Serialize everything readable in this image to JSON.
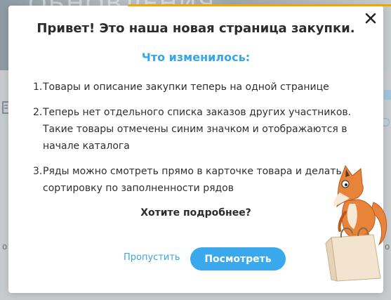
{
  "background": {
    "banner_text": "ОБНОВЛЕНИЯ",
    "left_fragment": "о",
    "right_fragment": "о"
  },
  "modal": {
    "title": "Привет! Это наша новая страница закупки.",
    "subtitle": "Что изменилось:",
    "changes": [
      {
        "number": "1.",
        "text": "Товары и описание закупки теперь на одной странице"
      },
      {
        "number": "2.",
        "text": "Теперь нет отдельного списка заказов других участников. Такие товары отмечены синим значком и отображаются в начале каталога"
      },
      {
        "number": "3.",
        "text": "Ряды можно смотреть прямо в карточке товара и делать сортировку по заполненности рядов"
      }
    ],
    "more_question": "Хотите подробнее?",
    "skip_label": "Пропустить",
    "view_label": "Посмотреть"
  },
  "colors": {
    "accent_blue": "#3aa8ec",
    "link_blue": "#35a6e6",
    "top_accent": "#f0a500",
    "fox_orange": "#e8833a"
  },
  "icons": {
    "close": "close-icon",
    "mascot": "fox-with-shopping-bag"
  }
}
